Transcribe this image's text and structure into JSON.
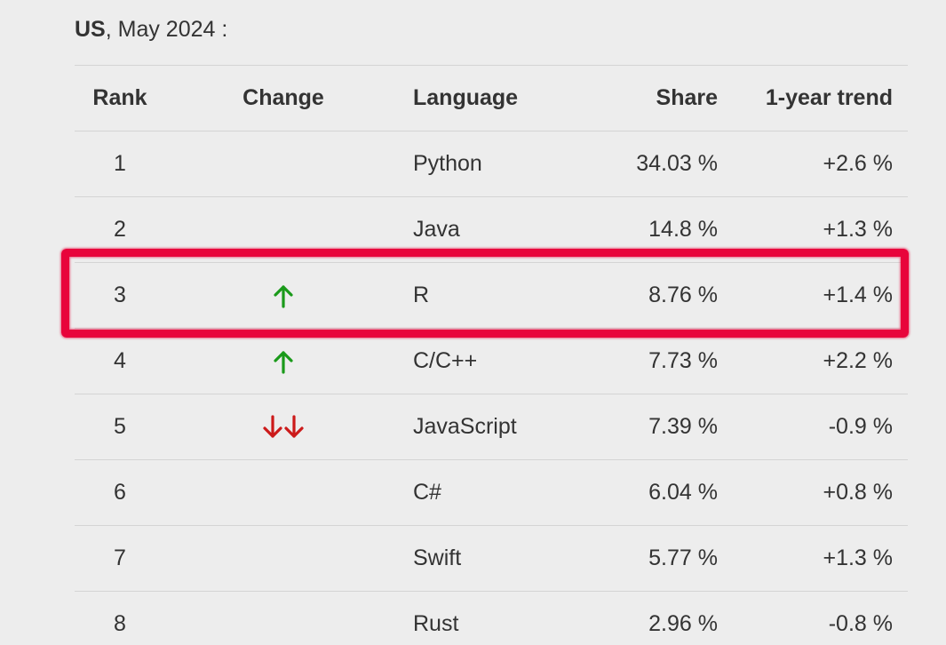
{
  "caption": {
    "region": "US",
    "rest": ", May 2024 :"
  },
  "table": {
    "headers": {
      "rank": "Rank",
      "change": "Change",
      "language": "Language",
      "share": "Share",
      "trend": "1-year trend"
    },
    "rows": [
      {
        "rank": "1",
        "change": "",
        "language": "Python",
        "share": "34.03 %",
        "trend": "+2.6 %"
      },
      {
        "rank": "2",
        "change": "",
        "language": "Java",
        "share": "14.8 %",
        "trend": "+1.3 %"
      },
      {
        "rank": "3",
        "change": "up",
        "language": "R",
        "share": "8.76 %",
        "trend": "+1.4 %"
      },
      {
        "rank": "4",
        "change": "up",
        "language": "C/C++",
        "share": "7.73 %",
        "trend": "+2.2 %"
      },
      {
        "rank": "5",
        "change": "down-down",
        "language": "JavaScript",
        "share": "7.39 %",
        "trend": "-0.9 %"
      },
      {
        "rank": "6",
        "change": "",
        "language": "C#",
        "share": "6.04 %",
        "trend": "+0.8 %"
      },
      {
        "rank": "7",
        "change": "",
        "language": "Swift",
        "share": "5.77 %",
        "trend": "+1.3 %"
      },
      {
        "rank": "8",
        "change": "",
        "language": "Rust",
        "share": "2.96 %",
        "trend": "-0.8 %"
      }
    ]
  },
  "icons": {
    "up": "arrow-up-icon",
    "down": "arrow-down-icon"
  },
  "colors": {
    "up_arrow": "#1a9a1a",
    "down_arrow": "#cc1a1a",
    "highlight": "#e8043b"
  },
  "highlighted_row_rank": "3"
}
